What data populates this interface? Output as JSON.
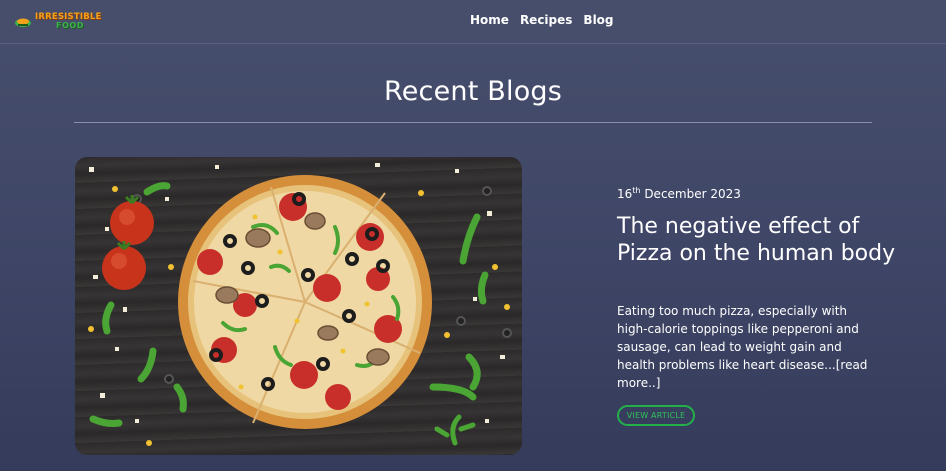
{
  "brand": {
    "logo_line1": "IRRESISTIBLE",
    "logo_line2": "FOOD",
    "logo_icon": "chef-hat-icon",
    "colors": {
      "logo_orange": "#f3a21a",
      "logo_green": "#3db24a"
    }
  },
  "nav": {
    "items": [
      {
        "label": "Home"
      },
      {
        "label": "Recipes"
      },
      {
        "label": "Blog"
      }
    ]
  },
  "page": {
    "title": "Recent Blogs"
  },
  "post": {
    "date_day": "16",
    "date_suffix": "th",
    "date_rest": " December 2023",
    "title": "The negative effect of Pizza on the human body",
    "excerpt": "Eating too much pizza, especially with high-calorie toppings like pepperoni and sausage, can lead to weight gain and health problems like heart disease...[read more..]",
    "button_label": "VIEW ARTICLE",
    "image_subject": "pizza-photo",
    "accent_color": "#22b04a"
  }
}
